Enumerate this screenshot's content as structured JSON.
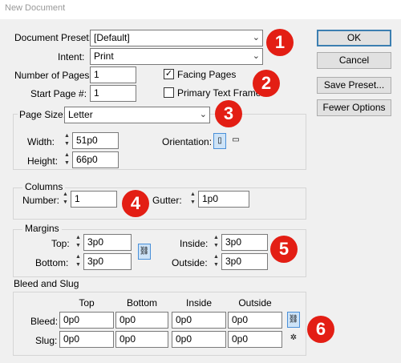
{
  "window": {
    "title": "New Document"
  },
  "document_preset": {
    "label": "Document Preset:",
    "value": "[Default]"
  },
  "intent": {
    "label": "Intent:",
    "value": "Print"
  },
  "pages": {
    "number_label": "Number of Pages:",
    "number_value": "1",
    "start_label": "Start Page #:",
    "start_value": "1",
    "facing_label": "Facing Pages",
    "facing_checked": "✓",
    "primary_label": "Primary Text Frame"
  },
  "page_size": {
    "label": "Page Size:",
    "value": "Letter",
    "width_label": "Width:",
    "width_value": "51p0",
    "height_label": "Height:",
    "height_value": "66p0",
    "orientation_label": "Orientation:"
  },
  "columns": {
    "title": "Columns",
    "number_label": "Number:",
    "number_value": "1",
    "gutter_label": "Gutter:",
    "gutter_value": "1p0"
  },
  "margins": {
    "title": "Margins",
    "top_label": "Top:",
    "top_value": "3p0",
    "bottom_label": "Bottom:",
    "bottom_value": "3p0",
    "inside_label": "Inside:",
    "inside_value": "3p0",
    "outside_label": "Outside:",
    "outside_value": "3p0"
  },
  "bleed_slug": {
    "title": "Bleed and Slug",
    "headers": [
      "Top",
      "Bottom",
      "Inside",
      "Outside"
    ],
    "bleed_label": "Bleed:",
    "bleed_values": [
      "0p0",
      "0p0",
      "0p0",
      "0p0"
    ],
    "slug_label": "Slug:",
    "slug_values": [
      "0p0",
      "0p0",
      "0p0",
      "0p0"
    ]
  },
  "buttons": {
    "ok": "OK",
    "cancel": "Cancel",
    "save_preset": "Save Preset...",
    "fewer_options": "Fewer Options"
  },
  "badges": [
    "1",
    "2",
    "3",
    "4",
    "5",
    "6"
  ],
  "colors": {
    "badge": "#e31e14",
    "dialog_bg": "#f0f0f0",
    "default_button_border": "#3c7fb1"
  },
  "icons": {
    "link": "chain-link-icon",
    "orientation_portrait": "portrait-orientation-icon",
    "orientation_landscape": "landscape-orientation-icon"
  }
}
